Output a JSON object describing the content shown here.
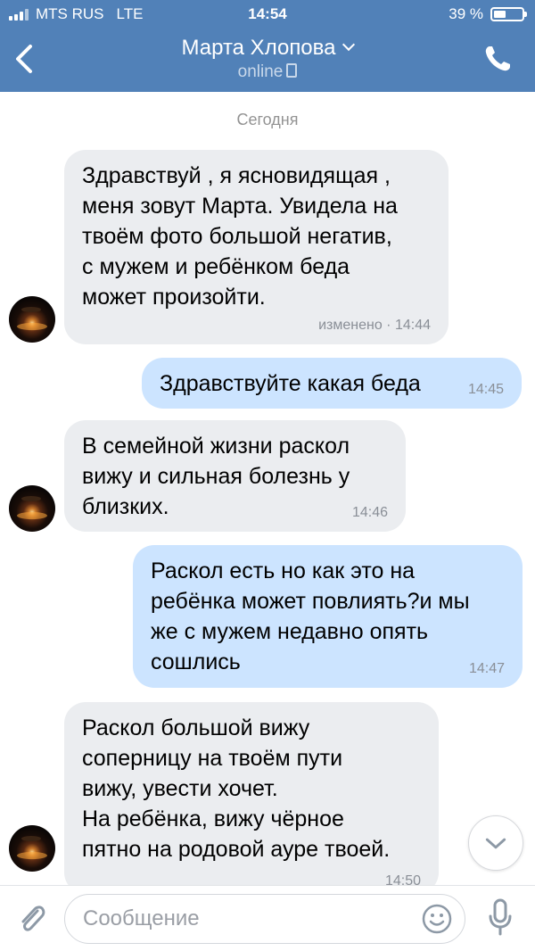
{
  "status_bar": {
    "carrier": "MTS RUS",
    "network": "LTE",
    "time": "14:54",
    "battery": "39 %"
  },
  "header": {
    "contact_name": "Марта Хлопова",
    "presence": "online",
    "icons": [
      "back-arrow-icon",
      "chevron-down-icon",
      "phone-icon",
      "mobile-device-icon"
    ]
  },
  "chat": {
    "date_divider": "Сегодня",
    "messages": [
      {
        "direction": "in",
        "text": "Здравствуй , я ясновидящая ,\nменя зовут Марта. Увидела на\nтвоём фото большой негатив,\nс мужем и ребёнком беда\nможет произойти.",
        "time": "изменено · 14:44"
      },
      {
        "direction": "out",
        "text": "Здравствуйте какая беда",
        "time": "14:45"
      },
      {
        "direction": "in",
        "text": "В семейной жизни раскол\nвижу и сильная болезнь у\nблизких.",
        "time": "14:46"
      },
      {
        "direction": "out",
        "text": "Раскол есть но как это на\nребёнка может повлиять?и мы\nже с мужем недавно опять\nсошлись",
        "time": "14:47"
      },
      {
        "direction": "in",
        "text": "Раскол большой вижу\nсоперницу на твоём пути\nвижу, увести хочет.\nНа ребёнка, вижу чёрное\nпятно на родовой ауре твоей.",
        "time": "14:50"
      }
    ]
  },
  "composer": {
    "placeholder": "Сообщение",
    "icons": [
      "paperclip-icon",
      "emoji-icon",
      "microphone-icon",
      "scroll-down-icon"
    ]
  },
  "colors": {
    "header_bg": "#5181b8",
    "incoming_bubble": "#ebedf0",
    "outgoing_bubble": "#cce4ff"
  }
}
